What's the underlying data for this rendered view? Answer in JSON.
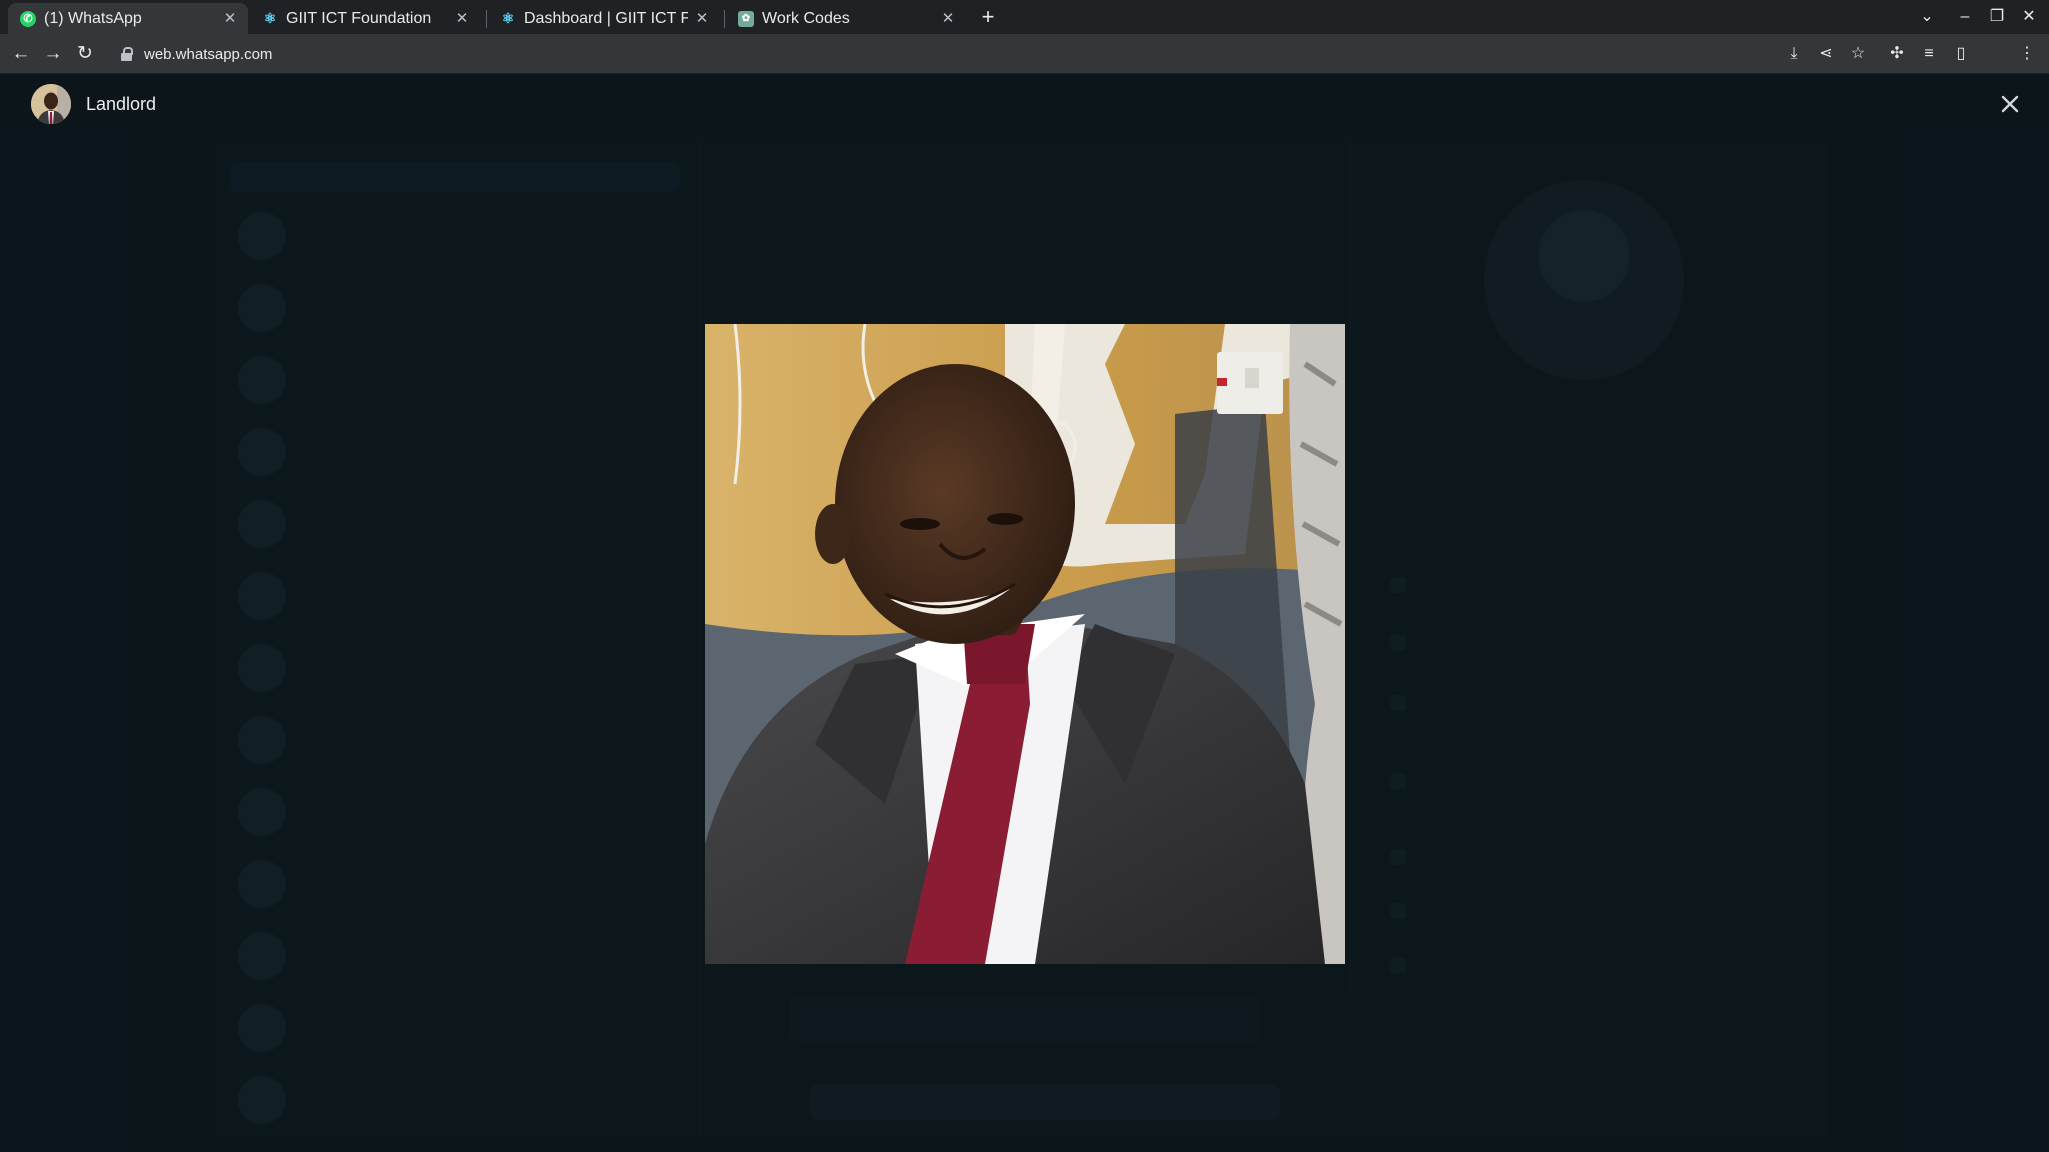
{
  "browser": {
    "tabs": [
      {
        "title": "(1) WhatsApp",
        "icon": "whatsapp-icon",
        "active": true
      },
      {
        "title": "GIIT ICT Foundation",
        "icon": "react-icon",
        "active": false
      },
      {
        "title": "Dashboard | GIIT ICT Foun",
        "icon": "react-icon",
        "active": false
      },
      {
        "title": "Work Codes",
        "icon": "chatgpt-icon",
        "active": false
      }
    ],
    "url": "web.whatsapp.com"
  },
  "viewer": {
    "contact_name": "Landlord"
  },
  "colors": {
    "whatsapp_green": "#25d366",
    "react_blue": "#61dafb",
    "chatgpt_green": "#74aa9c",
    "tie": "#8a1c33",
    "suit": "#3b3b3d"
  }
}
